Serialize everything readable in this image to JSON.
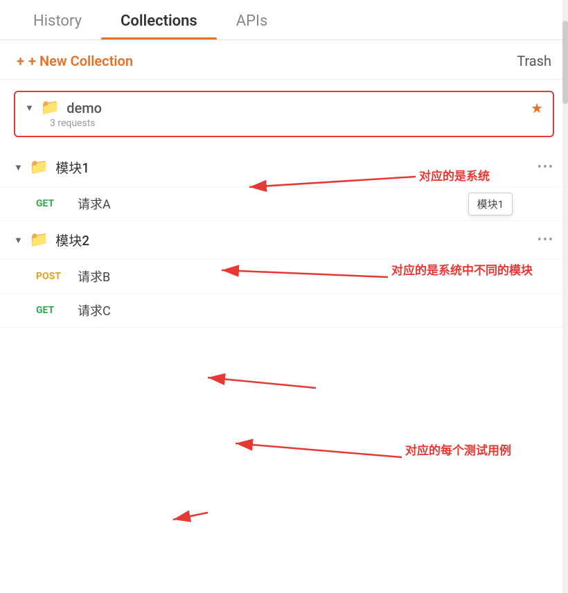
{
  "tabs": [
    {
      "id": "history",
      "label": "History",
      "active": false
    },
    {
      "id": "collections",
      "label": "Collections",
      "active": true
    },
    {
      "id": "apis",
      "label": "APIs",
      "active": false
    }
  ],
  "actions": {
    "new_collection": "+ New Collection",
    "trash": "Trash"
  },
  "demo_collection": {
    "name": "demo",
    "request_count": "3 requests",
    "starred": true
  },
  "modules": [
    {
      "id": "module1",
      "name": "模块1",
      "requests": [
        {
          "method": "GET",
          "name": "请求A"
        }
      ]
    },
    {
      "id": "module2",
      "name": "模块2",
      "requests": [
        {
          "method": "POST",
          "name": "请求B"
        },
        {
          "method": "GET",
          "name": "请求C"
        }
      ]
    }
  ],
  "annotations": [
    {
      "id": "ann1",
      "text": "对应的是系统",
      "target": "demo"
    },
    {
      "id": "ann2",
      "text": "对应的是系统中不同的模块",
      "target": "module1"
    },
    {
      "id": "ann3",
      "text": "对应的每个测试用例",
      "target": "requestB"
    }
  ],
  "tooltip": {
    "text": "模块1"
  },
  "colors": {
    "active_tab_underline": "#e8712a",
    "new_collection": "#e8712a",
    "star": "#e8712a",
    "get": "#2ea84f",
    "post": "#e8a020",
    "annotation_red": "#e53935"
  }
}
